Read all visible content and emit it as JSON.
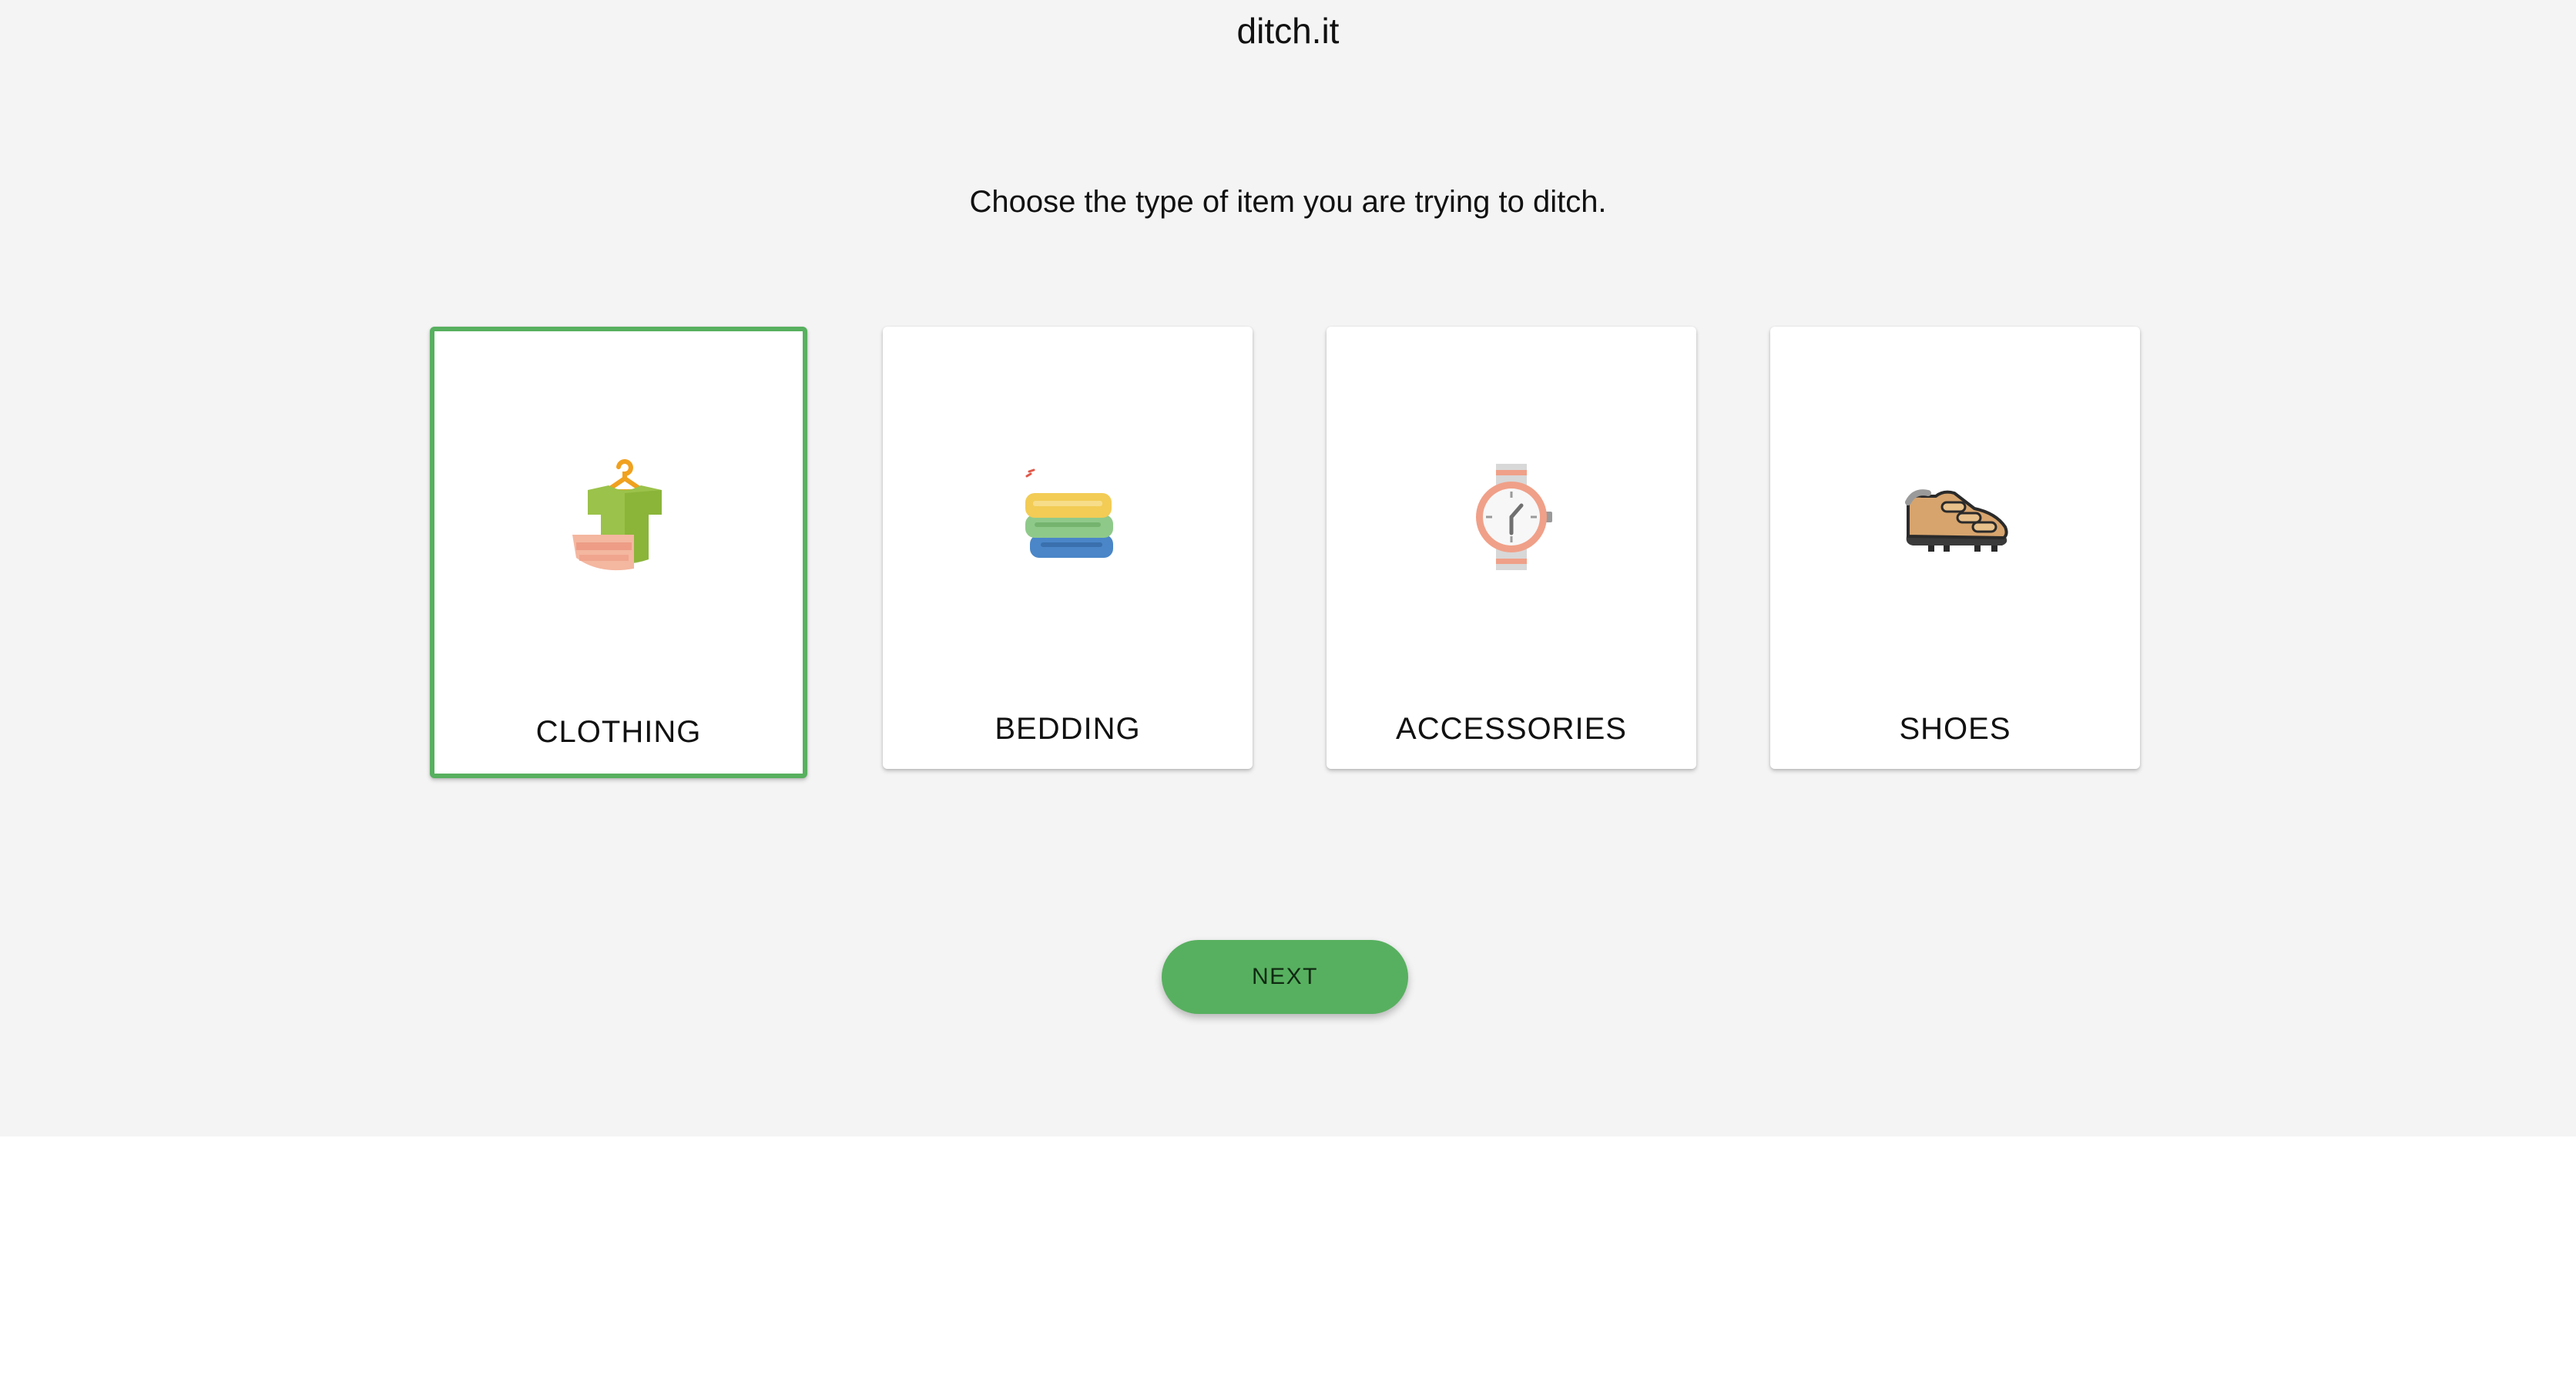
{
  "header": {
    "brand": "ditch.it"
  },
  "prompt": "Choose the type of item you are trying to ditch.",
  "categories": [
    {
      "label": "CLOTHING",
      "icon": "clothing-icon",
      "selected": true
    },
    {
      "label": "BEDDING",
      "icon": "bedding-icon",
      "selected": false
    },
    {
      "label": "ACCESSORIES",
      "icon": "watch-icon",
      "selected": false
    },
    {
      "label": "SHOES",
      "icon": "shoe-icon",
      "selected": false
    }
  ],
  "actions": {
    "next_label": "NEXT"
  },
  "colors": {
    "accent": "#57b05f",
    "background": "#f4f4f4",
    "card": "#ffffff"
  }
}
